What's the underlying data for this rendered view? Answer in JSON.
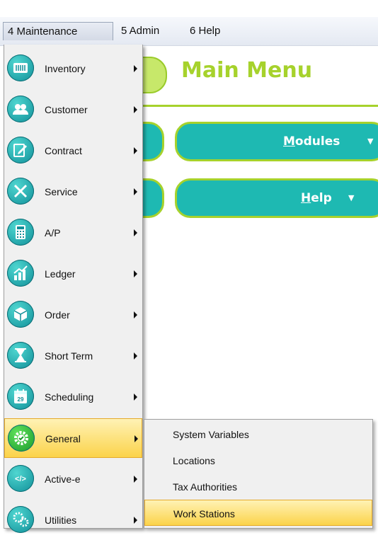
{
  "menubar": {
    "items": [
      {
        "label": "4 Maintenance"
      },
      {
        "label": "5 Admin"
      },
      {
        "label": "6 Help"
      }
    ]
  },
  "background": {
    "title": "Main Menu",
    "buttons": [
      {
        "label_underlined": "M",
        "label_rest": "odules",
        "caret": "▼"
      },
      {
        "label_underlined": "H",
        "label_rest": "elp",
        "caret": "▼"
      }
    ]
  },
  "dropdown": {
    "items": [
      {
        "label": "Inventory",
        "icon": "inventory-icon"
      },
      {
        "label": "Customer",
        "icon": "customer-icon"
      },
      {
        "label": "Contract",
        "icon": "contract-icon"
      },
      {
        "label": "Service",
        "icon": "service-icon"
      },
      {
        "label": "A/P",
        "icon": "calculator-icon"
      },
      {
        "label": "Ledger",
        "icon": "ledger-icon"
      },
      {
        "label": "Order",
        "icon": "order-icon"
      },
      {
        "label": "Short Term",
        "icon": "hourglass-icon"
      },
      {
        "label": "Scheduling",
        "icon": "calendar-icon",
        "badge": "29"
      },
      {
        "label": "General",
        "icon": "general-gear-icon",
        "highlighted": true
      },
      {
        "label": "Active-e",
        "icon": "code-icon",
        "glyph": "</>"
      },
      {
        "label": "Utilities",
        "icon": "utilities-gears-icon"
      }
    ]
  },
  "submenu": {
    "items": [
      {
        "label": "System Variables"
      },
      {
        "label": "Locations"
      },
      {
        "label": "Tax Authorities"
      },
      {
        "label": "Work Stations",
        "highlighted": true
      }
    ]
  },
  "colors": {
    "accent_green": "#a6d22c",
    "teal": "#1eb9b2",
    "highlight_yellow": "#fbd34a"
  }
}
